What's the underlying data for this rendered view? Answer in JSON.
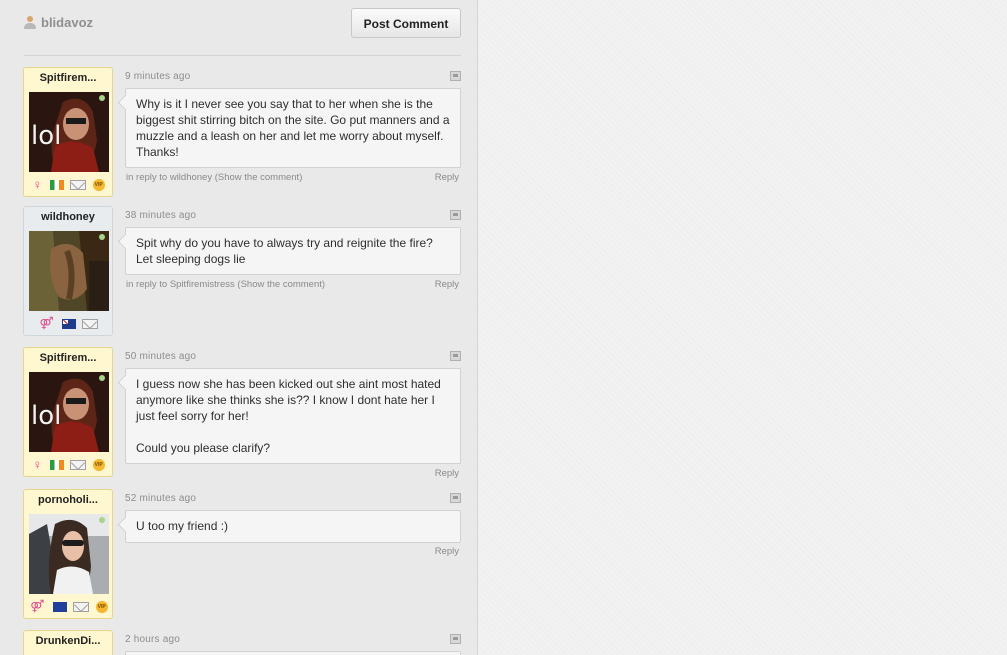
{
  "header": {
    "username": "blidavoz",
    "post_comment_label": "Post Comment"
  },
  "labels": {
    "reply": "Reply",
    "in_reply_to": "in reply to",
    "show_comment": "(Show the comment)"
  },
  "comments": [
    {
      "author": "Spitfirem...",
      "time": "9 minutes ago",
      "text": "Why is it I never see you say that to her when she is the biggest shit stirring bitch on the site. Go put manners and a muzzle and a leash on her and let me worry about myself. Thanks!",
      "reply_to": "wildhoney",
      "badges": [
        "female-icon",
        "ireland-flag-icon",
        "message-icon",
        "vip-icon"
      ]
    },
    {
      "author": "wildhoney",
      "time": "38 minutes ago",
      "text": "Spit why do you have to always try and reignite the fire? Let sleeping dogs lie",
      "reply_to": "Spitfiremistress",
      "badges": [
        "couple-icon",
        "australia-flag-icon",
        "message-icon"
      ]
    },
    {
      "author": "Spitfirem...",
      "time": "50 minutes ago",
      "text": "I guess now she has been kicked out she aint most hated anymore like she thinks she is?? I know I dont hate her I just feel sorry for her!\n\nCould you please clarify?",
      "reply_to": "",
      "badges": [
        "female-icon",
        "ireland-flag-icon",
        "message-icon",
        "vip-icon"
      ]
    },
    {
      "author": "pornoholi...",
      "time": "52 minutes ago",
      "text": "U too my friend :)",
      "reply_to": "",
      "badges": [
        "couple-icon",
        "eu-flag-icon",
        "message-icon",
        "vip-icon"
      ]
    },
    {
      "author": "DrunkenDi...",
      "time": "2 hours ago",
      "text": "",
      "reply_to": "",
      "badges": []
    }
  ],
  "colors": {
    "card_yellow": "#fff7cf",
    "card_blue": "#e8ecef",
    "panel_bg": "#e9e9e9",
    "female_pink": "#e0488c"
  }
}
